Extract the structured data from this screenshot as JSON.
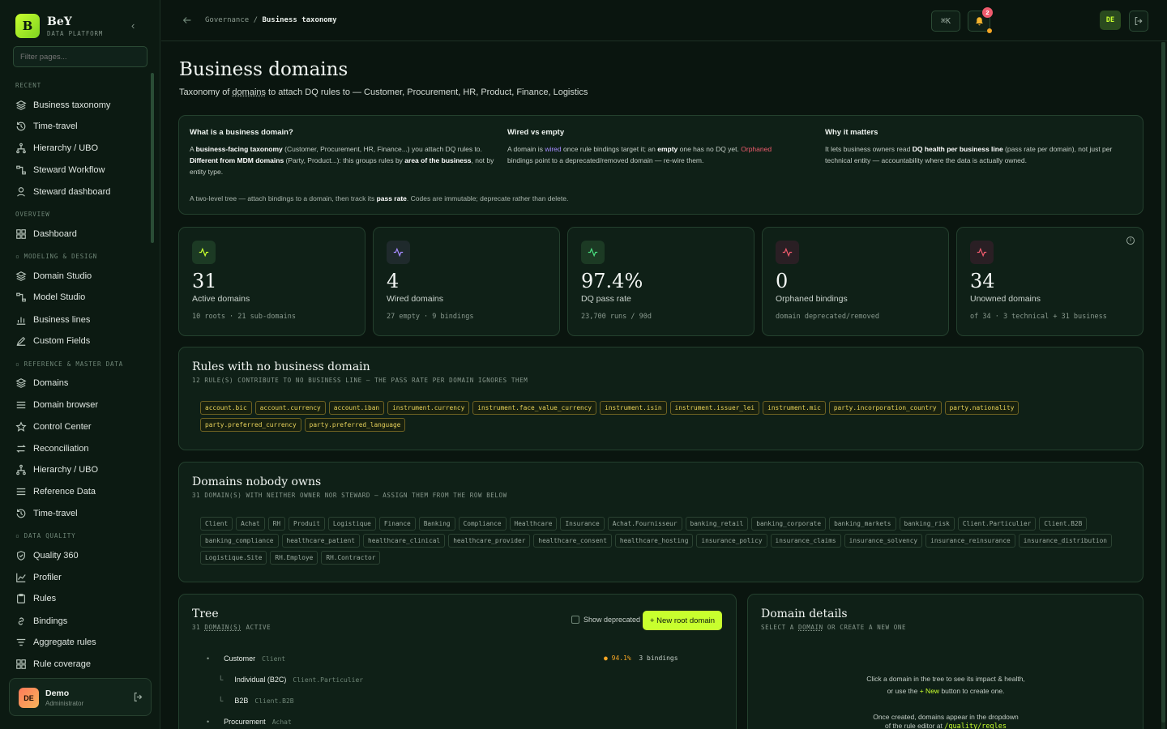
{
  "brand": {
    "name": "BeY",
    "sub": "DATA PLATFORM"
  },
  "sidebar": {
    "filter_placeholder": "Filter pages...",
    "sections": [
      {
        "label": "RECENT"
      },
      {
        "label": "OVERVIEW"
      },
      {
        "label": "MODELING & DESIGN"
      },
      {
        "label": "REFERENCE & MASTER DATA"
      },
      {
        "label": "DATA QUALITY"
      }
    ],
    "items": [
      {
        "label": "Business taxonomy",
        "icon": "layers-icon"
      },
      {
        "label": "Time-travel",
        "icon": "history-icon"
      },
      {
        "label": "Hierarchy / UBO",
        "icon": "hierarchy-icon"
      },
      {
        "label": "Steward Workflow",
        "icon": "workflow-icon"
      },
      {
        "label": "Steward dashboard",
        "icon": "user-icon"
      },
      {
        "label": "Dashboard",
        "icon": "grid-icon"
      },
      {
        "label": "Domain Studio",
        "icon": "layers-icon"
      },
      {
        "label": "Model Studio",
        "icon": "workflow-icon"
      },
      {
        "label": "Business lines",
        "icon": "bar-chart-icon"
      },
      {
        "label": "Custom Fields",
        "icon": "pencil-icon"
      },
      {
        "label": "Domains",
        "icon": "layers-icon"
      },
      {
        "label": "Domain browser",
        "icon": "list-icon"
      },
      {
        "label": "Control Center",
        "icon": "star-icon"
      },
      {
        "label": "Reconciliation",
        "icon": "arrows-icon"
      },
      {
        "label": "Hierarchy / UBO",
        "icon": "hierarchy-icon"
      },
      {
        "label": "Reference Data",
        "icon": "list-icon"
      },
      {
        "label": "Time-travel",
        "icon": "history-icon"
      },
      {
        "label": "Quality 360",
        "icon": "shield-icon"
      },
      {
        "label": "Profiler",
        "icon": "line-chart-icon"
      },
      {
        "label": "Rules",
        "icon": "clipboard-icon"
      },
      {
        "label": "Bindings",
        "icon": "link-icon"
      },
      {
        "label": "Aggregate rules",
        "icon": "filter-icon"
      },
      {
        "label": "Rule coverage",
        "icon": "grid-icon"
      }
    ],
    "user": {
      "initials": "DE",
      "name": "Demo",
      "role": "Administrator"
    }
  },
  "topbar": {
    "crumb_parent": "Governance",
    "crumb_sep": "/",
    "crumb_current": "Business taxonomy",
    "shortcut": "⌘K",
    "notifications": "2",
    "user_initials": "DE"
  },
  "page": {
    "title": "Business domains",
    "subtitle_pre": "Taxonomy of ",
    "subtitle_link": "domains",
    "subtitle_post": " to attach DQ rules to — Customer, Procurement, HR, Product, Finance, Logistics"
  },
  "info": {
    "col1_title": "What is a business domain?",
    "col2_title": "Wired vs empty",
    "col3_title": "Why it matters",
    "footer_pre": "A two-level tree — attach bindings to a domain, then track its ",
    "footer_bold": "pass rate",
    "footer_post": ". Codes are immutable; deprecate rather than delete."
  },
  "stats": [
    {
      "value": "31",
      "label": "Active domains",
      "sub": "10 roots · 21 sub-domains",
      "color": "#c8ff2e"
    },
    {
      "value": "4",
      "label": "Wired domains",
      "sub": "27 empty · 9 bindings",
      "color": "#a58bff"
    },
    {
      "value": "97.4%",
      "label": "DQ pass rate",
      "sub": "23,700 runs / 90d",
      "color": "#4ade80"
    },
    {
      "value": "0",
      "label": "Orphaned bindings",
      "sub": "domain deprecated/removed",
      "color": "#ef5b6d"
    },
    {
      "value": "34",
      "label": "Unowned domains",
      "sub": "of 34 · 3 technical + 31 business",
      "color": "#ef5b6d"
    }
  ],
  "no_domain": {
    "title": "Rules with no business domain",
    "sub": "12 RULE(S) CONTRIBUTE TO NO BUSINESS LINE — THE PASS RATE PER DOMAIN IGNORES THEM",
    "rules": [
      "account.bic",
      "account.currency",
      "account.iban",
      "instrument.currency",
      "instrument.face_value_currency",
      "instrument.isin",
      "instrument.issuer_lei",
      "instrument.mic",
      "party.incorporation_country",
      "party.nationality",
      "party.preferred_currency",
      "party.preferred_language"
    ]
  },
  "unowned": {
    "title": "Domains nobody owns",
    "sub": "31 DOMAIN(S) WITH NEITHER OWNER NOR STEWARD — ASSIGN THEM FROM THE ROW BELOW",
    "domains": [
      "Client",
      "Achat",
      "RH",
      "Produit",
      "Logistique",
      "Finance",
      "Banking",
      "Compliance",
      "Healthcare",
      "Insurance",
      "Achat.Fournisseur",
      "banking_retail",
      "banking_corporate",
      "banking_markets",
      "banking_risk",
      "Client.Particulier",
      "Client.B2B",
      "banking_compliance",
      "healthcare_patient",
      "healthcare_clinical",
      "healthcare_provider",
      "healthcare_consent",
      "healthcare_hosting",
      "insurance_policy",
      "insurance_claims",
      "insurance_solvency",
      "insurance_reinsurance",
      "insurance_distribution",
      "Logistique.Site",
      "RH.Employe",
      "RH.Contractor"
    ]
  },
  "tree": {
    "title": "Tree",
    "sub": "31 DOMAIN(S) ACTIVE",
    "show_deprecated": "Show deprecated",
    "new_button": "+ New root domain",
    "rows": [
      {
        "name": "Customer",
        "code": "Client",
        "rate": "94.1%",
        "bindings": "3 bindings"
      },
      {
        "name": "Individual (B2C)",
        "code": "Client.Particulier"
      },
      {
        "name": "B2B",
        "code": "Client.B2B"
      },
      {
        "name": "Procurement",
        "code": "Achat"
      }
    ]
  },
  "details": {
    "title": "Domain details",
    "sub": "SELECT A DOMAIN OR CREATE A NEW ONE",
    "line1": "Click a domain in the tree to see its impact & health,",
    "line2_pre": "or use the ",
    "line2_link": "+ New",
    "line2_post": " button to create one.",
    "line3": "Once created, domains appear in the dropdown",
    "line4_pre": "of the rule editor at ",
    "line4_code": "/quality/regles"
  }
}
